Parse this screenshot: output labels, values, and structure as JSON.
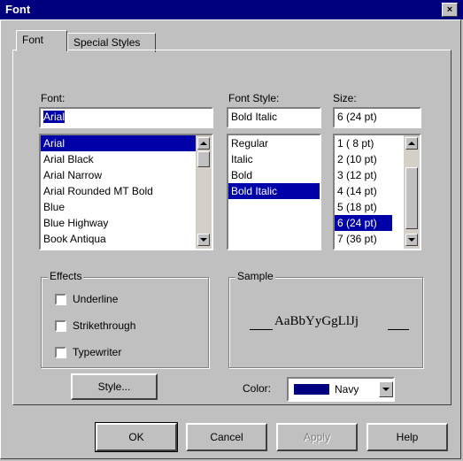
{
  "window": {
    "title": "Font",
    "close_glyph": "×"
  },
  "tabs": [
    {
      "label": "Font"
    },
    {
      "label": "Special Styles"
    }
  ],
  "font_field": {
    "label": "Font:",
    "value": "Arial"
  },
  "font_list": {
    "items": [
      "Arial",
      "Arial Black",
      "Arial Narrow",
      "Arial Rounded MT Bold",
      "Blue",
      "Blue Highway",
      "Book Antiqua"
    ],
    "selected": "Arial"
  },
  "style_field": {
    "label": "Font Style:",
    "value": "Bold Italic"
  },
  "style_list": {
    "items": [
      "Regular",
      "Italic",
      "Bold",
      "Bold Italic"
    ],
    "selected": "Bold Italic"
  },
  "size_field": {
    "label": "Size:",
    "value": "6 (24 pt)"
  },
  "size_list": {
    "items": [
      "1  ( 8 pt)",
      "2  (10 pt)",
      "3  (12 pt)",
      "4  (14 pt)",
      "5  (18 pt)",
      "6  (24 pt)",
      "7  (36 pt)"
    ],
    "selected": "6  (24 pt)"
  },
  "effects": {
    "title": "Effects",
    "options": [
      "Underline",
      "Strikethrough",
      "Typewriter"
    ]
  },
  "sample": {
    "title": "Sample",
    "text": "AaBbYyGgLlJj"
  },
  "style_button": {
    "label": "Style..."
  },
  "color": {
    "label": "Color:",
    "value": "Navy",
    "swatch": "#000080"
  },
  "buttons": {
    "ok": "OK",
    "cancel": "Cancel",
    "apply": "Apply",
    "help": "Help"
  },
  "icons": {
    "close": "close-icon",
    "up": "scroll-up-icon",
    "down": "scroll-down-icon",
    "dropdown": "dropdown-arrow-icon"
  }
}
